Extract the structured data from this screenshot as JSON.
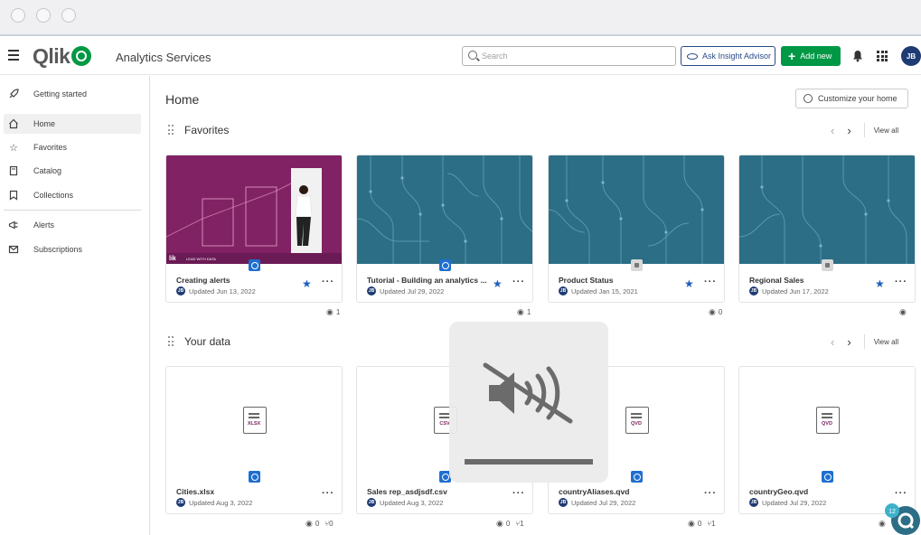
{
  "header": {
    "brand": "Qlik",
    "app_title": "Analytics Services",
    "search_placeholder": "Search",
    "insight_button": "Ask Insight Advisor",
    "add_new_button": "Add new",
    "user_initials": "JB"
  },
  "sidebar": {
    "items": [
      {
        "label": "Getting started",
        "icon": "rocket-icon"
      },
      {
        "label": "Home",
        "icon": "home-icon",
        "active": true
      },
      {
        "label": "Favorites",
        "icon": "star-icon"
      },
      {
        "label": "Catalog",
        "icon": "catalog-icon"
      },
      {
        "label": "Collections",
        "icon": "bookmark-icon"
      },
      {
        "label": "Alerts",
        "icon": "alert-icon"
      },
      {
        "label": "Subscriptions",
        "icon": "mail-icon"
      }
    ]
  },
  "main": {
    "title": "Home",
    "customize_button": "Customize your home",
    "view_all": "View all",
    "favorites": {
      "title": "Favorites",
      "cards": [
        {
          "name": "Creating alerts",
          "updated": "Updated Jun 13, 2022",
          "views": "1",
          "favorited": true,
          "thumb": "photo",
          "thumb_text": "LEAD WITH DATA"
        },
        {
          "name": "Tutorial - Building an analytics ...",
          "updated": "Updated Jul 29, 2022",
          "views": "1",
          "favorited": true,
          "thumb": "pattern"
        },
        {
          "name": "Product Status",
          "updated": "Updated Jan 15, 2021",
          "views": "0",
          "favorited": true,
          "thumb": "pattern"
        },
        {
          "name": "Regional Sales",
          "updated": "Updated Jun 17, 2022",
          "views": "",
          "favorited": true,
          "thumb": "pattern"
        }
      ]
    },
    "your_data": {
      "title": "Your data",
      "cards": [
        {
          "name": "Cities.xlsx",
          "updated": "Updated Aug 3, 2022",
          "ext": "XLSX",
          "views": "0",
          "lineage": "0"
        },
        {
          "name": "Sales rep_asdjsdf.csv",
          "updated": "Updated Aug 3, 2022",
          "ext": "CSV",
          "views": "0",
          "lineage": "1"
        },
        {
          "name": "countryAliases.qvd",
          "updated": "Updated Jul 29, 2022",
          "ext": "QVD",
          "views": "0",
          "lineage": "1"
        },
        {
          "name": "countryGeo.qvd",
          "updated": "Updated Jul 29, 2022",
          "ext": "QVD",
          "views": "",
          "lineage": ""
        }
      ]
    }
  },
  "chat_bubble": {
    "count": "12"
  },
  "colors": {
    "brand_green": "#009845",
    "navy": "#1f3b73",
    "teal": "#2b6e86",
    "magenta": "#7a2260",
    "star_blue": "#1f5fbf"
  }
}
